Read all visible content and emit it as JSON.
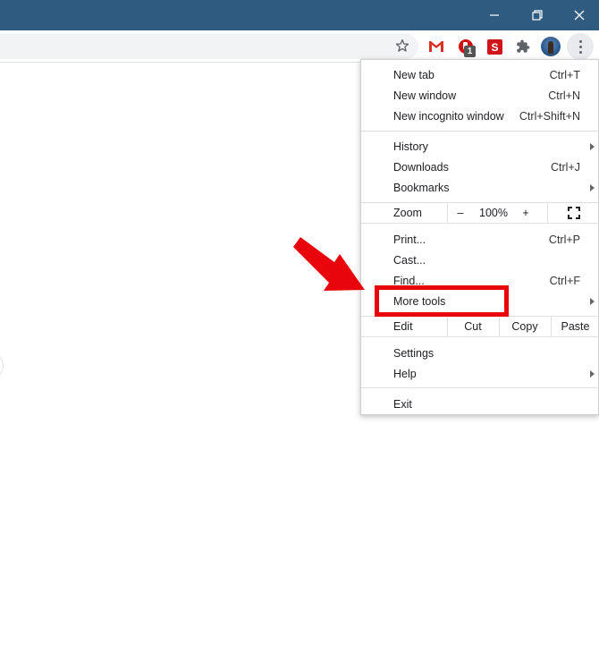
{
  "window": {
    "controls": {
      "minimize": "minimize",
      "restore": "restore",
      "close": "close"
    }
  },
  "toolbar": {
    "bookmark_icon": "star-icon",
    "extensions": [
      {
        "name": "gmail",
        "icon": "gmail-icon"
      },
      {
        "name": "adblock",
        "icon": "adblock-hand-icon",
        "badge": "1"
      },
      {
        "name": "s-extension",
        "icon": "s-logo-icon",
        "letter": "S"
      },
      {
        "name": "extensions",
        "icon": "puzzle-icon"
      }
    ],
    "profile": "avatar",
    "menu": "kebab-menu-icon"
  },
  "menu": {
    "section1": [
      {
        "label": "New tab",
        "shortcut": "Ctrl+T"
      },
      {
        "label": "New window",
        "shortcut": "Ctrl+N"
      },
      {
        "label": "New incognito window",
        "shortcut": "Ctrl+Shift+N"
      }
    ],
    "section2": [
      {
        "label": "History",
        "submenu": true
      },
      {
        "label": "Downloads",
        "shortcut": "Ctrl+J"
      },
      {
        "label": "Bookmarks",
        "submenu": true
      }
    ],
    "zoom": {
      "label": "Zoom",
      "minus": "–",
      "value": "100%",
      "plus": "+"
    },
    "section3": [
      {
        "label": "Print...",
        "shortcut": "Ctrl+P"
      },
      {
        "label": "Cast..."
      },
      {
        "label": "Find...",
        "shortcut": "Ctrl+F"
      },
      {
        "label": "More tools",
        "submenu": true
      }
    ],
    "edit": {
      "label": "Edit",
      "cut": "Cut",
      "copy": "Copy",
      "paste": "Paste"
    },
    "section4": [
      {
        "label": "Settings"
      },
      {
        "label": "Help",
        "submenu": true
      }
    ],
    "exit": {
      "label": "Exit"
    }
  },
  "annotation": {
    "highlight_target": "More tools",
    "color": "#e8060c"
  }
}
